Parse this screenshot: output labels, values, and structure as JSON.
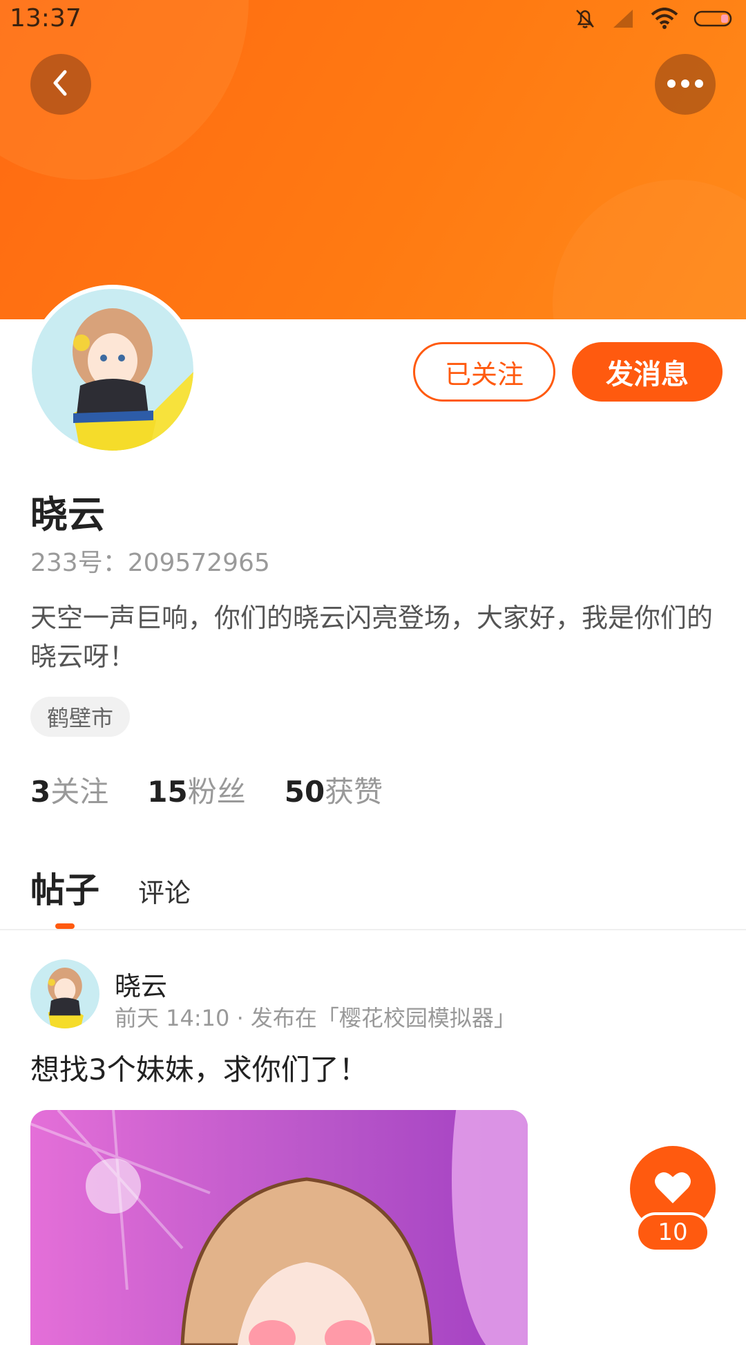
{
  "status_bar": {
    "time": "13:37",
    "icons": [
      "mute-bell-icon",
      "no-signal-icon",
      "wifi-icon",
      "battery-icon"
    ]
  },
  "header": {
    "back_icon": "chevron-left-icon",
    "more_icon": "more-dots-icon",
    "banner_color": "#ff7214"
  },
  "actions": {
    "follow_label": "已关注",
    "message_label": "发消息",
    "accent_color": "#ff5a0f"
  },
  "profile": {
    "name": "晓云",
    "id_text": "233号：209572965",
    "bio": "天空一声巨响，你们的晓云闪亮登场，大家好，我是你们的晓云呀！",
    "location_tag": "鹤壁市"
  },
  "stats": [
    {
      "num": "3",
      "label": "关注"
    },
    {
      "num": "15",
      "label": "粉丝"
    },
    {
      "num": "50",
      "label": "获赞"
    }
  ],
  "tabs": {
    "posts": "帖子",
    "comments": "评论"
  },
  "post": {
    "author": "晓云",
    "meta": "前天 14:10 · 发布在「樱花校园模拟器」",
    "title": "想找3个妹妹，求你们了！"
  },
  "like": {
    "icon": "heart-icon",
    "count": "10"
  }
}
